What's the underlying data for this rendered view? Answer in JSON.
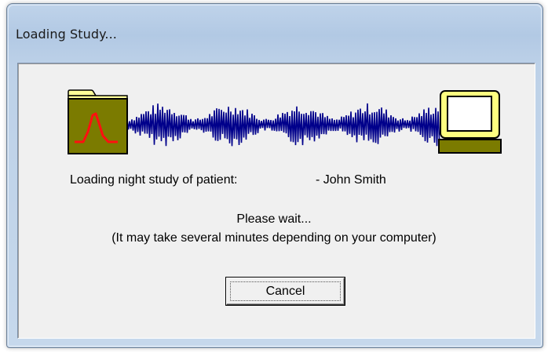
{
  "window": {
    "title": "Loading Study..."
  },
  "message": {
    "patient_label": "Loading night study of patient:",
    "patient_name": "- John Smith",
    "wait_line1": "Please wait...",
    "wait_line2": "(It may take several minutes depending on your computer)"
  },
  "buttons": {
    "cancel_label": "Cancel"
  },
  "icons": {
    "folder": "folder-icon",
    "waveform": "waveform-graphic",
    "computer": "computer-icon"
  },
  "colors": {
    "wave": "#00008b",
    "folder": "#7b7b00",
    "folder_tab": "#ffff99",
    "curve": "#ff0000",
    "monitor_frame": "#ffff80"
  }
}
